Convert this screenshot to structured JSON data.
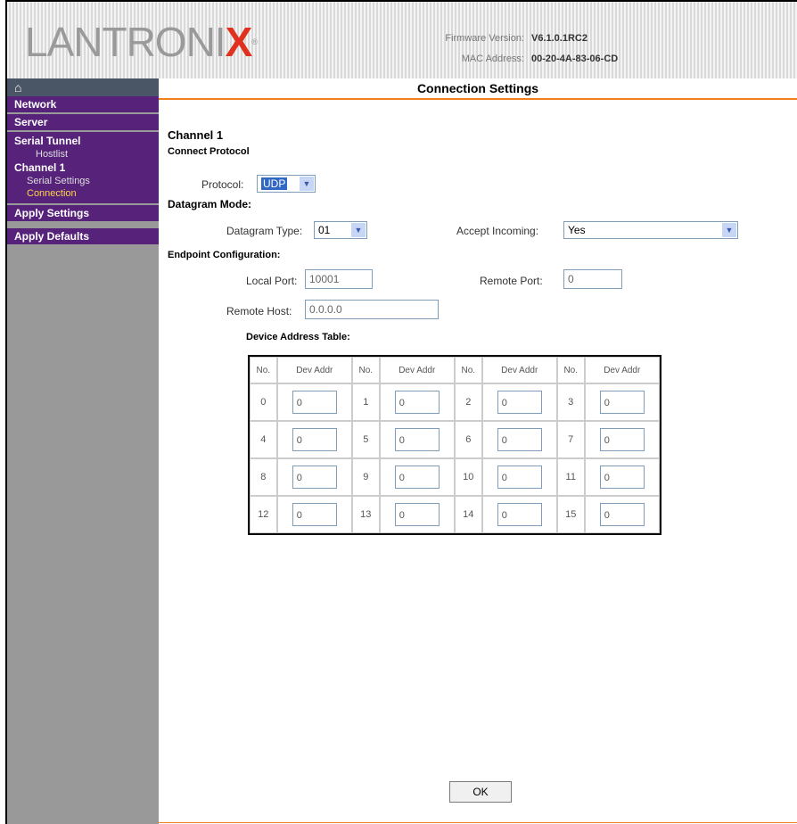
{
  "header": {
    "logo_text": "LANTRONI",
    "logo_accent": "X",
    "logo_reg": "®",
    "firmware_label": "Firmware Version:",
    "firmware_value": "V6.1.0.1RC2",
    "mac_label": "MAC Address:",
    "mac_value": "00-20-4A-83-06-CD"
  },
  "sidebar": {
    "home_icon": "home-icon",
    "network": "Network",
    "server": "Server",
    "serial_tunnel": "Serial Tunnel",
    "hostlist": "Hostlist",
    "channel1": "Channel 1",
    "serial_settings": "Serial Settings",
    "connection": "Connection",
    "apply_settings": "Apply Settings",
    "apply_defaults": "Apply Defaults"
  },
  "main": {
    "title": "Connection Settings",
    "channel": "Channel 1",
    "connect_protocol": "Connect Protocol",
    "protocol_label": "Protocol:",
    "protocol_value": "UDP",
    "datagram_mode": "Datagram Mode:",
    "datagram_type_label": "Datagram Type:",
    "datagram_type_value": "01",
    "accept_incoming_label": "Accept Incoming:",
    "accept_incoming_value": "Yes",
    "endpoint_config": "Endpoint Configuration:",
    "local_port_label": "Local Port:",
    "local_port_value": "10001",
    "remote_port_label": "Remote Port:",
    "remote_port_value": "0",
    "remote_host_label": "Remote Host:",
    "remote_host_value": "0.0.0.0",
    "device_table_title": "Device Address Table:",
    "table_headers": [
      "No.",
      "Dev Addr",
      "No.",
      "Dev Addr",
      "No.",
      "Dev Addr",
      "No.",
      "Dev Addr"
    ],
    "table_rows": [
      [
        "0",
        "0",
        "1",
        "0",
        "2",
        "0",
        "3",
        "0"
      ],
      [
        "4",
        "0",
        "5",
        "0",
        "6",
        "0",
        "7",
        "0"
      ],
      [
        "8",
        "0",
        "9",
        "0",
        "10",
        "0",
        "11",
        "0"
      ],
      [
        "12",
        "0",
        "13",
        "0",
        "14",
        "0",
        "15",
        "0"
      ]
    ],
    "ok_button": "OK"
  },
  "colors": {
    "nav_purple": "#57237a",
    "accent_orange": "#f07f1e",
    "logo_red": "#e0301e"
  }
}
